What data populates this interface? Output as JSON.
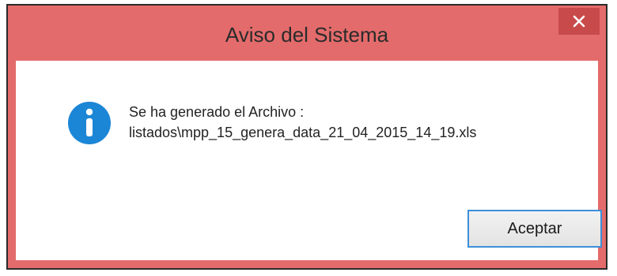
{
  "dialog": {
    "title": "Aviso del Sistema",
    "close_icon": "close-icon",
    "message_line1": "Se ha generado el Archivo :",
    "message_line2": "listados\\mpp_15_genera_data_21_04_2015_14_19.xls",
    "info_icon": "info-icon",
    "ok_label": "Aceptar"
  },
  "colors": {
    "titlebar": "#e46b6b",
    "close_button": "#c84a4a",
    "info_icon": "#1c86d6",
    "button_border": "#3c8fd8"
  }
}
